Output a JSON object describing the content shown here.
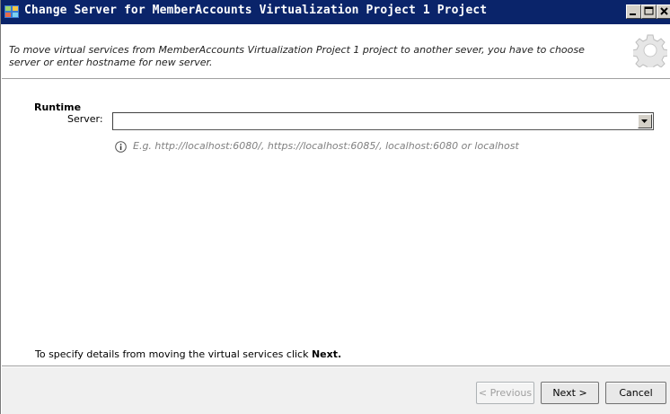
{
  "window": {
    "title": "Change Server for MemberAccounts Virtualization Project 1 Project",
    "title_bar_color": "#0a246a"
  },
  "header": {
    "instructions": "To move virtual services from MemberAccounts Virtualization Project 1 project to another sever, you have to choose server or enter hostname for new server.",
    "icon": "gear-icon"
  },
  "form": {
    "section_label": "Runtime",
    "server_label": "Server:",
    "server_value": "",
    "hint_icon": "info-icon",
    "hint": "E.g. http://localhost:6080/, https://localhost:6085/, localhost:6080 or localhost"
  },
  "footer": {
    "note_prefix": "To specify details from moving the virtual services click ",
    "note_bold": "Next."
  },
  "buttons": {
    "previous": "< Previous",
    "next": "Next >",
    "cancel": "Cancel"
  }
}
